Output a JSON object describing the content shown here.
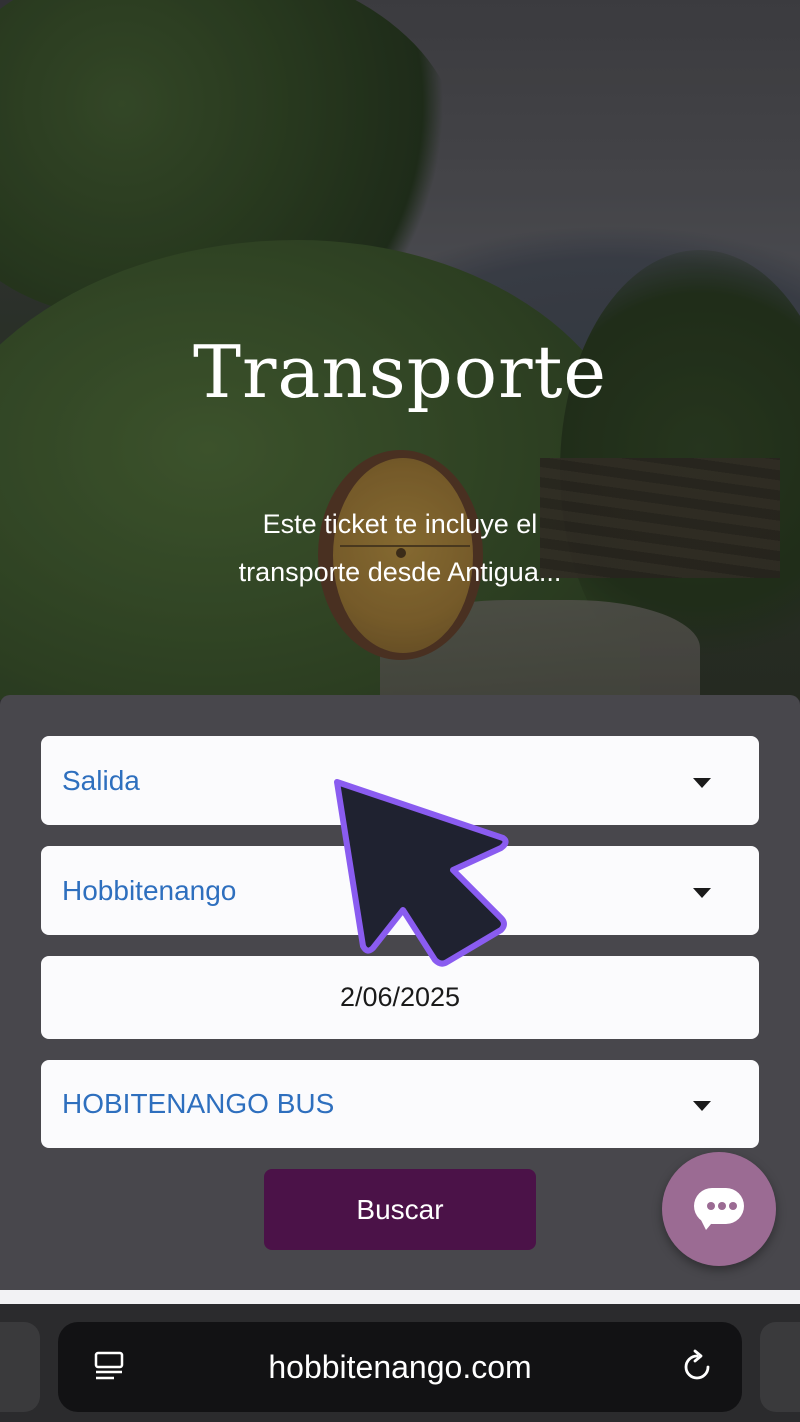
{
  "hero": {
    "title": "Transporte",
    "subtitle": "Este ticket te incluye el transporte desde Antigua..."
  },
  "form": {
    "origin_select": {
      "value": "Salida"
    },
    "destination_select": {
      "value": "Hobbitenango"
    },
    "date_field": {
      "value": "2/06/2025"
    },
    "bus_select": {
      "value": "HOBITENANGO BUS"
    },
    "search_label": "Buscar"
  },
  "chat": {
    "icon": "chat-bubble-icon"
  },
  "browser": {
    "url": "hobbitenango.com",
    "tabs_icon": "tabs-icon",
    "reload_icon": "reload-icon"
  },
  "colors": {
    "accent_purple": "#4b1248",
    "chat_button": "#9b6b93",
    "field_text_blue": "#2e6fbe",
    "card_bg": "#48474c",
    "cursor_fill": "#1f2230",
    "cursor_outline": "#8a5cf0"
  }
}
